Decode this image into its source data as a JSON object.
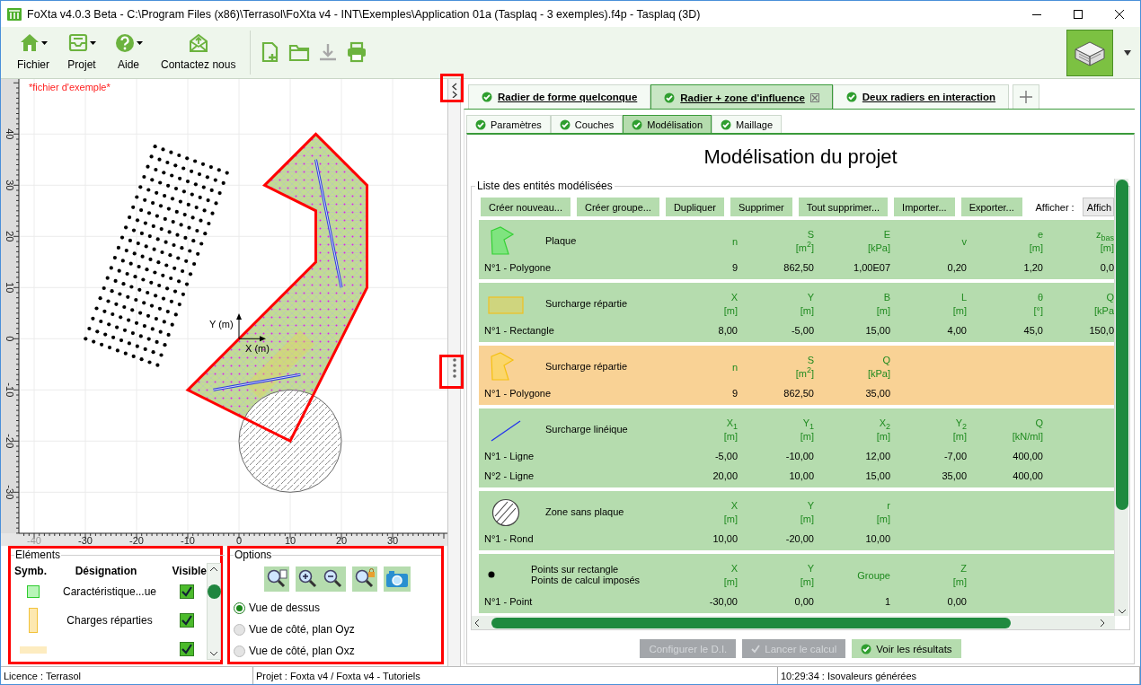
{
  "window": {
    "title": "FoXta v4.0.3 Beta - C:\\Program Files (x86)\\Terrasol\\FoXta v4 - INT\\Exemples\\Application 01a (Tasplaq - 3 exemples).f4p - Tasplaq (3D)"
  },
  "ribbon": {
    "menus": [
      {
        "kind": "home",
        "label": "Fichier",
        "dropdown": true
      },
      {
        "kind": "project",
        "label": "Projet",
        "dropdown": true
      },
      {
        "kind": "help",
        "label": "Aide",
        "dropdown": true
      },
      {
        "kind": "contact",
        "label": "Contactez nous",
        "dropdown": false
      }
    ],
    "tools": [
      {
        "kind": "new",
        "disabled": false
      },
      {
        "kind": "open",
        "disabled": false
      },
      {
        "kind": "download",
        "disabled": true
      },
      {
        "kind": "print",
        "disabled": false
      }
    ]
  },
  "plot": {
    "note": "*fichier d'exemple*",
    "x_ticks": [
      "-40",
      "-30",
      "-20",
      "-10",
      "0",
      "10",
      "20",
      "30"
    ],
    "y_ticks": [
      "-30",
      "-20",
      "-10",
      "0",
      "10",
      "20",
      "30",
      "40"
    ],
    "x_axis": "X (m)",
    "y_axis": "Y (m)"
  },
  "elements": {
    "title": "Eléments",
    "columns": [
      "Symb.",
      "Désignation",
      "Visible"
    ],
    "rows": [
      {
        "kind": "plate",
        "name": "Caractéristique...ue",
        "visible": true
      },
      {
        "kind": "area-load",
        "name": "Charges réparties",
        "visible": true
      },
      {
        "kind": "strip",
        "visible": true
      }
    ]
  },
  "options": {
    "title": "Options",
    "views": [
      {
        "label": "Vue de dessus",
        "selected": true
      },
      {
        "label": "Vue de côté, plan Oyz",
        "selected": false
      },
      {
        "label": "Vue de côté, plan Oxz",
        "selected": false
      }
    ]
  },
  "tabs": [
    {
      "label": "Radier de forme quelconque",
      "selected": false
    },
    {
      "label": "Radier + zone d'influence",
      "selected": true
    },
    {
      "label": "Deux radiers en interaction",
      "selected": false
    }
  ],
  "subtabs": [
    {
      "label": "Paramètres",
      "selected": false
    },
    {
      "label": "Couches",
      "selected": false
    },
    {
      "label": "Modélisation",
      "selected": true
    },
    {
      "label": "Maillage",
      "selected": false
    }
  ],
  "page_title": "Modélisation du projet",
  "entities": {
    "title": "Liste des entités modélisées",
    "actions": [
      "Créer nouveau...",
      "Créer groupe...",
      "Dupliquer",
      "Supprimer",
      "Tout supprimer...",
      "Importer...",
      "Exporter..."
    ],
    "display": {
      "label": "Afficher :",
      "value": "Affich"
    },
    "blocks": [
      {
        "kind": "plate",
        "selected": false,
        "title": [
          "Plaque"
        ],
        "columns": [
          {
            "name": "n"
          },
          {
            "name": "S",
            "unit": "[m$^{2}$]"
          },
          {
            "name": "E",
            "unit": "[kPa]"
          },
          {
            "name": "v"
          },
          {
            "name": "e",
            "unit": "[m]"
          },
          {
            "name": "z$_{bas}$",
            "unit": "[m]"
          }
        ],
        "rows": [
          {
            "label": "N°1 - Polygone",
            "values": [
              "9",
              "862,50",
              "1,00E07",
              "0,20",
              "1,20",
              "0,0"
            ]
          }
        ]
      },
      {
        "kind": "area-load-rect",
        "selected": false,
        "title": [
          "Surcharge répartie"
        ],
        "columns": [
          {
            "name": "X",
            "unit": "[m]"
          },
          {
            "name": "Y",
            "unit": "[m]"
          },
          {
            "name": "B",
            "unit": "[m]"
          },
          {
            "name": "L",
            "unit": "[m]"
          },
          {
            "name": "θ",
            "unit": "[°]"
          },
          {
            "name": "Q",
            "unit": "[kPa"
          }
        ],
        "rows": [
          {
            "label": "N°1 - Rectangle",
            "values": [
              "8,00",
              "-5,00",
              "15,00",
              "4,00",
              "45,0",
              "150,0"
            ]
          }
        ]
      },
      {
        "kind": "area-load-polygon",
        "selected": true,
        "title": [
          "Surcharge répartie"
        ],
        "columns": [
          {
            "name": "n"
          },
          {
            "name": "S",
            "unit": "[m$^{2}$]"
          },
          {
            "name": "Q",
            "unit": "[kPa]"
          }
        ],
        "rows": [
          {
            "label": "N°1 - Polygone",
            "values": [
              "9",
              "862,50",
              "35,00"
            ]
          }
        ]
      },
      {
        "kind": "line-load",
        "selected": false,
        "title": [
          "Surcharge linéique"
        ],
        "columns": [
          {
            "name": "X$_{1}$",
            "unit": "[m]"
          },
          {
            "name": "Y$_{1}$",
            "unit": "[m]"
          },
          {
            "name": "X$_{2}$",
            "unit": "[m]"
          },
          {
            "name": "Y$_{2}$",
            "unit": "[m]"
          },
          {
            "name": "Q",
            "unit": "[kN/ml]"
          }
        ],
        "rows": [
          {
            "label": "N°1 - Ligne",
            "values": [
              "-5,00",
              "-10,00",
              "12,00",
              "-7,00",
              "400,00"
            ]
          },
          {
            "label": "N°2 - Ligne",
            "values": [
              "20,00",
              "10,00",
              "15,00",
              "35,00",
              "400,00"
            ]
          }
        ]
      },
      {
        "kind": "void-zone",
        "selected": false,
        "title": [
          "Zone sans plaque"
        ],
        "columns": [
          {
            "name": "X",
            "unit": "[m]"
          },
          {
            "name": "Y",
            "unit": "[m]"
          },
          {
            "name": "r",
            "unit": "[m]"
          }
        ],
        "rows": [
          {
            "label": "N°1 - Rond",
            "values": [
              "10,00",
              "-20,00",
              "10,00"
            ]
          }
        ]
      },
      {
        "kind": "points",
        "selected": false,
        "title": [
          "Points sur rectangle",
          "Points de calcul imposés"
        ],
        "columns": [
          {
            "name": "X",
            "unit": "[m]"
          },
          {
            "name": "Y",
            "unit": "[m]"
          },
          {
            "name": "Groupe"
          },
          {
            "name": "Z",
            "unit": "[m]"
          }
        ],
        "rows": [
          {
            "label": "N°1 - Point",
            "values": [
              "-30,00",
              "0,00",
              "1",
              "0,00"
            ]
          }
        ]
      }
    ]
  },
  "footer_buttons": [
    {
      "label": "Configurer le D.I.",
      "disabled": true,
      "check": false
    },
    {
      "label": "Lancer le calcul",
      "disabled": true,
      "check": true
    },
    {
      "label": "Voir les résultats",
      "disabled": false,
      "check": true
    }
  ],
  "status_bar": [
    "Licence : Terrasol",
    "Projet : Foxta v4 / Foxta v4 - Tutoriels",
    "10:29:34 : Isovaleurs générées"
  ]
}
